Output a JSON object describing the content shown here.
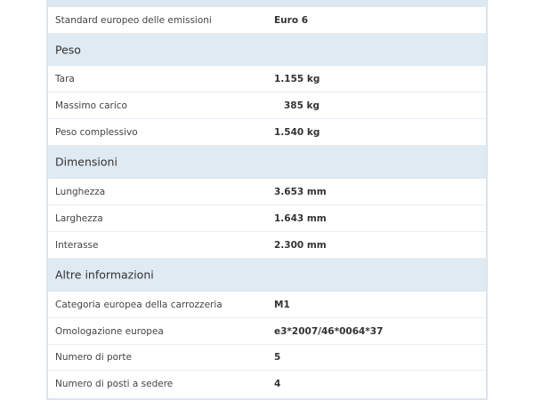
{
  "rows_top": [
    {
      "label": "Standard europeo delle emissioni",
      "value": "Euro 6"
    }
  ],
  "peso": {
    "title": "Peso",
    "rows": [
      {
        "label": "Tara",
        "value": "1.155 kg"
      },
      {
        "label": "Massimo carico",
        "value": "   385 kg"
      },
      {
        "label": "Peso complessivo",
        "value": "1.540 kg"
      }
    ]
  },
  "dimensioni": {
    "title": "Dimensioni",
    "rows": [
      {
        "label": "Lunghezza",
        "value": "3.653 mm"
      },
      {
        "label": "Larghezza",
        "value": "1.643 mm"
      },
      {
        "label": "Interasse",
        "value": "2.300 mm"
      }
    ]
  },
  "altre": {
    "title": "Altre informazioni",
    "rows": [
      {
        "label": "Categoria europea della carrozzeria",
        "value": "M1"
      },
      {
        "label": "Omologazione europea",
        "value": "e3*2007/46*0064*37"
      },
      {
        "label": "Numero di porte",
        "value": "5"
      },
      {
        "label": "Numero di posti a sedere",
        "value": "4"
      }
    ]
  }
}
